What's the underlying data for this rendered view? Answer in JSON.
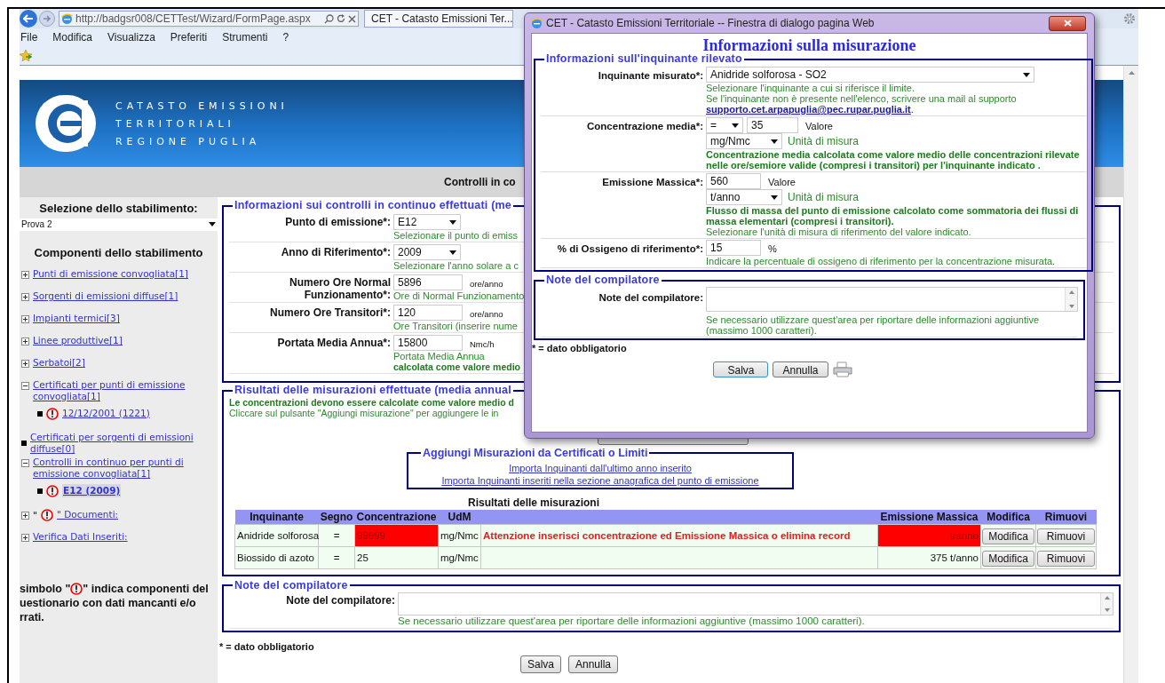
{
  "browser": {
    "address": "http://badgsr008/CETTest/Wizard/FormPage.aspx",
    "tab": "CET - Catasto Emissioni Ter...",
    "menu": [
      "File",
      "Modifica",
      "Visualizza",
      "Preferiti",
      "Strumenti",
      "?"
    ]
  },
  "header": {
    "lines": [
      "CATASTO EMISSIONI",
      "TERRITORIALI",
      "REGIONE PUGLIA"
    ]
  },
  "page_title": "Controlli in co",
  "sidebar": {
    "select_label": "Selezione dello stabilimento:",
    "select_value": "Prova 2",
    "components_title": "Componenti dello stabilimento",
    "items": [
      {
        "kind": "node",
        "label": "Punti di emissione convogliata[1]",
        "expanded": false
      },
      {
        "kind": "node",
        "label": "Sorgenti di emissioni diffuse[1]",
        "expanded": false
      },
      {
        "kind": "node",
        "label": "Impianti termici[3]",
        "expanded": false
      },
      {
        "kind": "node",
        "label": "Linee produttive[1]",
        "expanded": false
      },
      {
        "kind": "node",
        "label": "Serbatoi[2]",
        "expanded": false
      },
      {
        "kind": "node",
        "label": "Certificati per punti di emissione convogliata[1]",
        "expanded": true,
        "children": [
          {
            "label": "12/12/2001 (1221)",
            "warning": true,
            "selected": false
          }
        ]
      },
      {
        "kind": "leaf",
        "label": "Certificati per sorgenti di emissioni diffuse[0]"
      },
      {
        "kind": "node",
        "label": "Controlli in continuo per punti di emissione convogliata[1]",
        "expanded": true,
        "children": [
          {
            "label": "E12 (2009)",
            "warning": true,
            "selected": true
          }
        ]
      },
      {
        "kind": "node",
        "label": "\" Documenti:",
        "prefix": "\"",
        "warning": true,
        "expanded": false
      },
      {
        "kind": "node",
        "label": "Verifica Dati Inseriti:",
        "expanded": false
      }
    ],
    "legend_before": "simbolo \"",
    "legend_after": "\" indica componenti del",
    "legend_rest": "uestionario con dati mancanti e/o rrati."
  },
  "controls_section": {
    "legend": "Informazioni sui controlli in continuo effettuati (me",
    "rows": [
      {
        "label": "Punto di emissione*:",
        "kind": "select",
        "value": "E12",
        "hint": "Selezionare il punto di emiss"
      },
      {
        "label": "Anno di Riferimento*:",
        "kind": "select",
        "value": "2009",
        "hint": "Selezionare l'anno solare a c"
      },
      {
        "label": "Numero Ore Normal Funzionamento*:",
        "kind": "input",
        "value": "5896",
        "unit": "ore/anno",
        "hint": "Ore di Normal Funzionamento"
      },
      {
        "label": "Numero Ore Transitori*:",
        "kind": "input",
        "value": "120",
        "unit": "ore/anno",
        "hint": "Ore Transitori (inserire nume"
      },
      {
        "label": "Portata Media Annua*:",
        "kind": "input",
        "value": "15800",
        "unit": "Nmc/h",
        "hint": "Portata Media Annua",
        "hint_bold": "calcolata come valore medio"
      }
    ]
  },
  "results_section": {
    "legend": "Risultati delle misurazioni effettuate (media annual",
    "intro_bold": "Le concentrazioni devono essere calcolate come valore medio d",
    "intro": "Cliccare sul pulsante \"Aggiungi misurazione\" per aggiungere le in",
    "import_box": {
      "legend": "Aggiungi Misurazioni da Certificati o Limiti",
      "links": [
        "Importa Inquinanti dall'ultimo anno inserito",
        "Importa Inquinanti inseriti nella sezione anagrafica del punto di emissione"
      ]
    },
    "table": {
      "caption": "Risultati delle misurazioni",
      "columns_left": [
        "Inquinante",
        "Segno",
        "Concentrazione",
        "UdM"
      ],
      "columns_right": [
        "Emissione Massica",
        "Modifica",
        "Rimuovi"
      ],
      "rows": [
        {
          "inquinante": "Anidride solforosa",
          "segno": "=",
          "concentrazione": "99999",
          "concentrazione_error": true,
          "udm": "mg/Nmc",
          "message": "Attenzione inserisci concentrazione ed Emissione Massica o elimina record",
          "emissione": "t/anno",
          "emissione_error": true,
          "actions": [
            "Modifica",
            "Rimuovi"
          ]
        },
        {
          "inquinante": "Biossido di azoto",
          "segno": "=",
          "concentrazione": "25",
          "concentrazione_error": false,
          "udm": "mg/Nmc",
          "emissione": "375 t/anno",
          "emissione_error": false,
          "actions": [
            "Modifica",
            "Rimuovi"
          ]
        }
      ]
    }
  },
  "notes": {
    "legend": "Note del compilatore",
    "label": "Note del compilatore:",
    "hint": "Se necessario utilizzare quest'area per riportare delle informazioni aggiuntive (massimo 1000 caratteri)."
  },
  "required_note": "* = dato obbligatorio",
  "buttons": [
    "Salva",
    "Annulla"
  ],
  "dialog": {
    "title": "CET - Catasto Emissioni Territoriale -- Finestra di dialogo pagina Web",
    "heading": "Informazioni sulla misurazione",
    "pollutant_section": {
      "legend": "Informazioni sull'inquinante rilevato",
      "rows": [
        {
          "label": "Inquinante misurato*:",
          "select_wide": "Anidride solforosa - SO2",
          "hints": [
            {
              "text": "Selezionare l'inquinante a cui si riferisce il limite.",
              "bold": false
            },
            {
              "text": "Se l'inquinante non è presente nell'elenco, scrivere una mail al supporto",
              "bold": false
            }
          ],
          "link": "supporto.cet.arpapuglia@pec.rupar.puglia.it",
          "link_after": "."
        },
        {
          "label": "Concentrazione media*:",
          "sign": "=",
          "value": "35",
          "value_unit": "Valore",
          "unit_select": "mg/Nmc",
          "unit_label": "Unità di misura",
          "hints": [
            {
              "text": "Concentrazione media calcolata come valore medio delle concentrazioni rilevate nelle ore/semiore valide (compresi i transitori) per l'inquinante indicato .",
              "bold": true
            }
          ]
        },
        {
          "label": "Emissione Massica*:",
          "value": "560",
          "value_unit": "Valore",
          "unit_select": "t/anno",
          "unit_label": "Unità di misura",
          "hints": [
            {
              "text": "Flusso di massa del punto di emissione calcolato come sommatoria dei flussi di massa elementari (compresi i transitori).",
              "bold": true
            },
            {
              "text": "Selezionare l'unità di misura di riferimento del valore indicato.",
              "bold": false
            }
          ]
        },
        {
          "label": "% di Ossigeno di riferimento*:",
          "value": "15",
          "value_unit": "%",
          "hints": [
            {
              "text": "Indicare la percentuale di ossigeno di riferimento per la concentrazione misurata.",
              "bold": false
            }
          ]
        }
      ]
    },
    "notes": {
      "legend": "Note del compilatore",
      "label": "Note del compilatore:",
      "hint": "Se necessario utilizzare quest'area per riportare delle informazioni aggiuntive (massimo 1000 caratteri)."
    },
    "required_note": "* = dato obbligatorio",
    "buttons": [
      {
        "label": "Salva",
        "focused": true
      },
      {
        "label": "Annulla",
        "focused": false
      }
    ]
  }
}
